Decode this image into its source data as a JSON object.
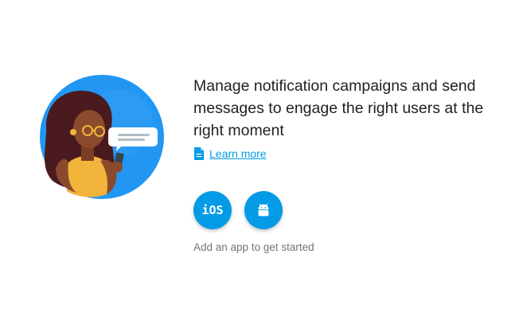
{
  "headline": "Manage notification campaigns and send messages to engage the right users at the right moment",
  "learn_more": {
    "label": "Learn more",
    "icon": "document-icon"
  },
  "platforms": {
    "ios_label": "iOS",
    "android_icon": "android-icon"
  },
  "hint": "Add an app to get started",
  "colors": {
    "accent": "#039be5",
    "illustration_blue": "#2196f3",
    "text_primary": "#212121",
    "text_secondary": "#757575"
  }
}
